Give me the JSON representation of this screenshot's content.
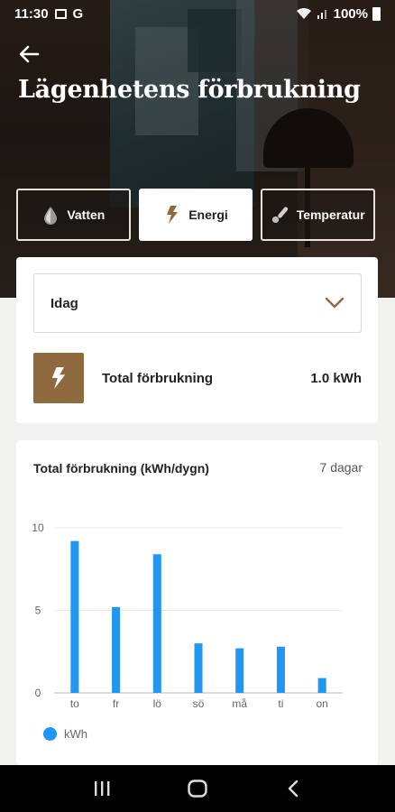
{
  "status_bar": {
    "time": "11:30",
    "g_label": "G",
    "battery": "100%"
  },
  "header": {
    "title": "Lägenhetens förbrukning"
  },
  "tabs": [
    {
      "label": "Vatten",
      "icon": "water-drop-icon",
      "active": false
    },
    {
      "label": "Energi",
      "icon": "lightning-icon",
      "active": true
    },
    {
      "label": "Temperatur",
      "icon": "thermometer-icon",
      "active": false
    }
  ],
  "period_select": {
    "value": "Idag"
  },
  "total": {
    "label": "Total förbrukning",
    "value": "1.0 kWh"
  },
  "colors": {
    "accent": "#8e6a3e",
    "bar": "#2196f3"
  },
  "chart_data": {
    "type": "bar",
    "title": "Total förbrukning (kWh/dygn)",
    "range_label": "7 dagar",
    "categories": [
      "to",
      "fr",
      "lö",
      "sö",
      "må",
      "ti",
      "on"
    ],
    "series": [
      {
        "name": "kWh",
        "values": [
          9.2,
          5.2,
          8.4,
          3.0,
          2.7,
          2.8,
          0.9
        ]
      }
    ],
    "ylim": [
      0,
      10
    ],
    "yticks": [
      0,
      5,
      10
    ],
    "grid": true,
    "legend": "bottom-left"
  }
}
